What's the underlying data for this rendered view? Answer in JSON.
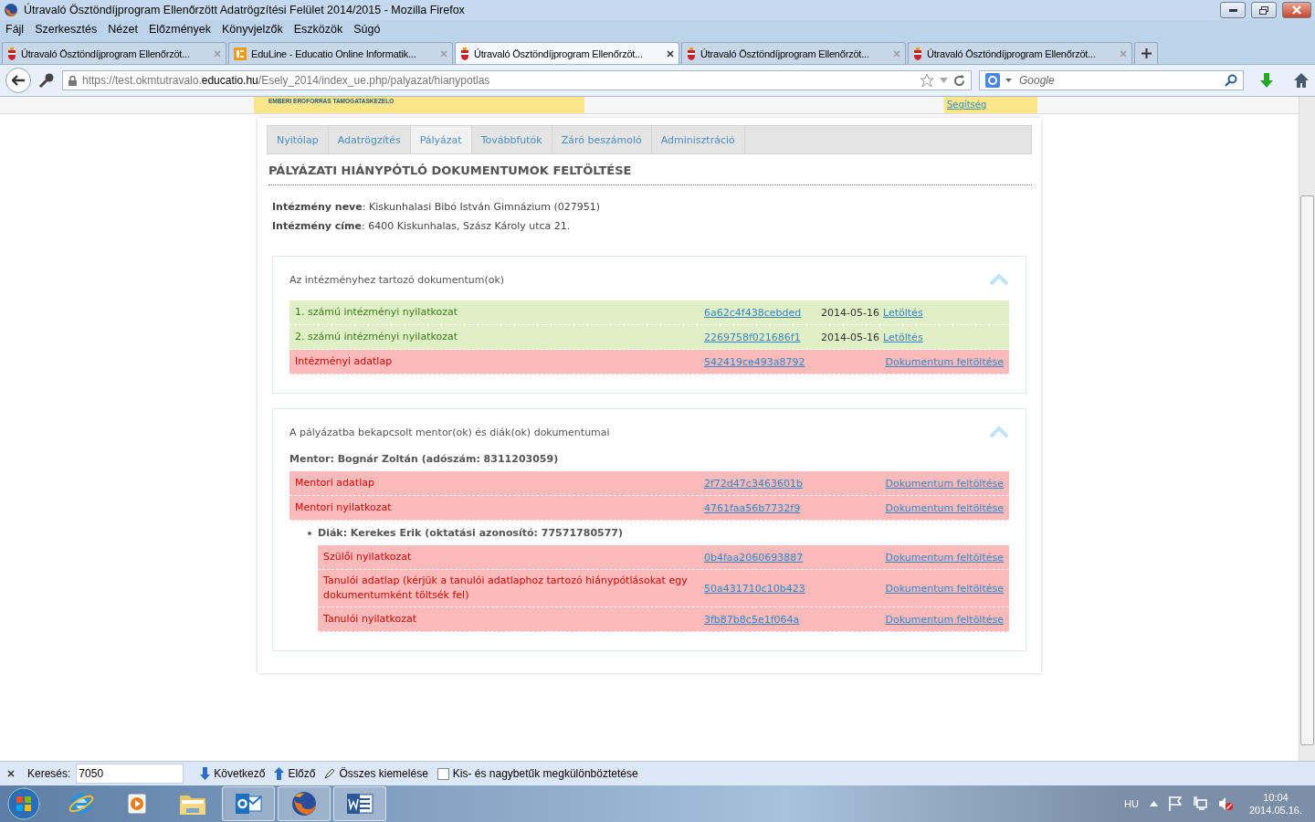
{
  "window": {
    "title": "Útravaló Ösztöndíjprogram Ellenőrzött Adatrögzítési Felület 2014/2015 - Mozilla Firefox"
  },
  "menu": [
    "Fájl",
    "Szerkesztés",
    "Nézet",
    "Előzmények",
    "Könyvjelzők",
    "Eszközök",
    "Súgó"
  ],
  "browser_tabs": [
    {
      "title": "Útravaló Ösztöndíjprogram Ellenőrzöt...",
      "kind": "crest",
      "selected": false
    },
    {
      "title": "EduLine - Educatio Online Informatik...",
      "kind": "eduline",
      "selected": false
    },
    {
      "title": "Útravaló Ösztöndíjprogram Ellenőrzöt...",
      "kind": "crest",
      "selected": true
    },
    {
      "title": "Útravaló Ösztöndíjprogram Ellenőrzöt...",
      "kind": "crest",
      "selected": false
    },
    {
      "title": "Útravaló Ösztöndíjprogram Ellenőrzöt...",
      "kind": "crest",
      "selected": false
    }
  ],
  "address": {
    "prefix": "https://test.okmtutravalo.",
    "domain": "educatio.hu",
    "path": "/Esely_2014/index_ue.php/palyazat/hianypotlas"
  },
  "search": {
    "placeholder": "Google"
  },
  "site": {
    "logo_text": "EMBERI EROFORRAS TAMOGATASKEZELO",
    "help_link": "Segítség"
  },
  "nav_tabs": [
    {
      "label": "Nyitólap",
      "selected": false
    },
    {
      "label": "Adatrögzítés",
      "selected": false
    },
    {
      "label": "Pályázat",
      "selected": true
    },
    {
      "label": "Továbbfutók",
      "selected": false
    },
    {
      "label": "Záró beszámoló",
      "selected": false
    },
    {
      "label": "Adminisztráció",
      "selected": false
    }
  ],
  "heading": "PÁLYÁZATI HIÁNYPÓTLÓ DOKUMENTUMOK FELTÖLTÉSE",
  "info": [
    "**Intézmény neve**: Kiskunhalasi Bibó István Gimnázium (027951)",
    "**Intézmény címe**: 6400 Kiskunhalas, Szász Károly utca 21."
  ],
  "institution_panel": {
    "title": "Az intézményhez tartozó dokumentum(ok)",
    "rows": [
      {
        "name": "1. számú intézményi nyilatkozat",
        "hash": "6a62c4f438cebded",
        "date": "2014-05-16",
        "action": "Letöltés",
        "kind": "uploaded"
      },
      {
        "name": "2. számú intézményi nyilatkozat",
        "hash": "2269758f021686f1",
        "date": "2014-05-16",
        "action": "Letöltés",
        "kind": "uploaded"
      },
      {
        "name": "Intézményi adatlap",
        "hash": "542419ce493a8792",
        "action": "Dokumentum feltöltése",
        "kind": "missing"
      }
    ]
  },
  "mentor_panel": {
    "title": "A pályázatba bekapcsolt mentor(ok) és diák(ok) dokumentumai",
    "mentor": "Mentor: Bognár Zoltán (adószám: 8311203059)",
    "rows": [
      {
        "name": "Mentori adatlap",
        "hash": "2f72d47c3463601b",
        "action": "Dokumentum feltöltése",
        "kind": "missing"
      },
      {
        "name": "Mentori nyilatkozat",
        "hash": "4761faa56b7732f9",
        "action": "Dokumentum feltöltése",
        "kind": "missing"
      }
    ],
    "student": "Diák: Kerekes Erik (oktatási azonosító: 77571780577)",
    "student_rows": [
      {
        "name": "Szülői nyilatkozat",
        "hash": "0b4faa2060693887",
        "action": "Dokumentum feltöltése",
        "kind": "missing"
      },
      {
        "name": "Tanulói adatlap (kérjük a tanulói adatlaphoz tartozó hiánypótlásokat egy dokumentumként töltsék fel)",
        "hash": "50a431710c10b423",
        "action": "Dokumentum feltöltése",
        "kind": "missing"
      },
      {
        "name": "Tanulói nyilatkozat",
        "hash": "3fb87b8c5e1f064a",
        "action": "Dokumentum feltöltése",
        "kind": "missing"
      }
    ]
  },
  "find_bar": {
    "label": "Keresés:",
    "value": "7050",
    "next": "Következő",
    "previous": "Előző",
    "highlight_all": "Összes kiemelése",
    "match_case": {
      "label": "Kis- és nagybetűk megkülönböztetése",
      "checked": false
    }
  },
  "taskbar": {
    "apps": [
      {
        "kind": "ie",
        "open": false
      },
      {
        "kind": "media",
        "open": false
      },
      {
        "kind": "folder",
        "open": false
      },
      {
        "kind": "outlook",
        "open": true
      },
      {
        "kind": "firefox",
        "open": true
      },
      {
        "kind": "word",
        "open": true
      }
    ],
    "language": "HU",
    "time": "10:04",
    "date": "2014.05.16."
  }
}
